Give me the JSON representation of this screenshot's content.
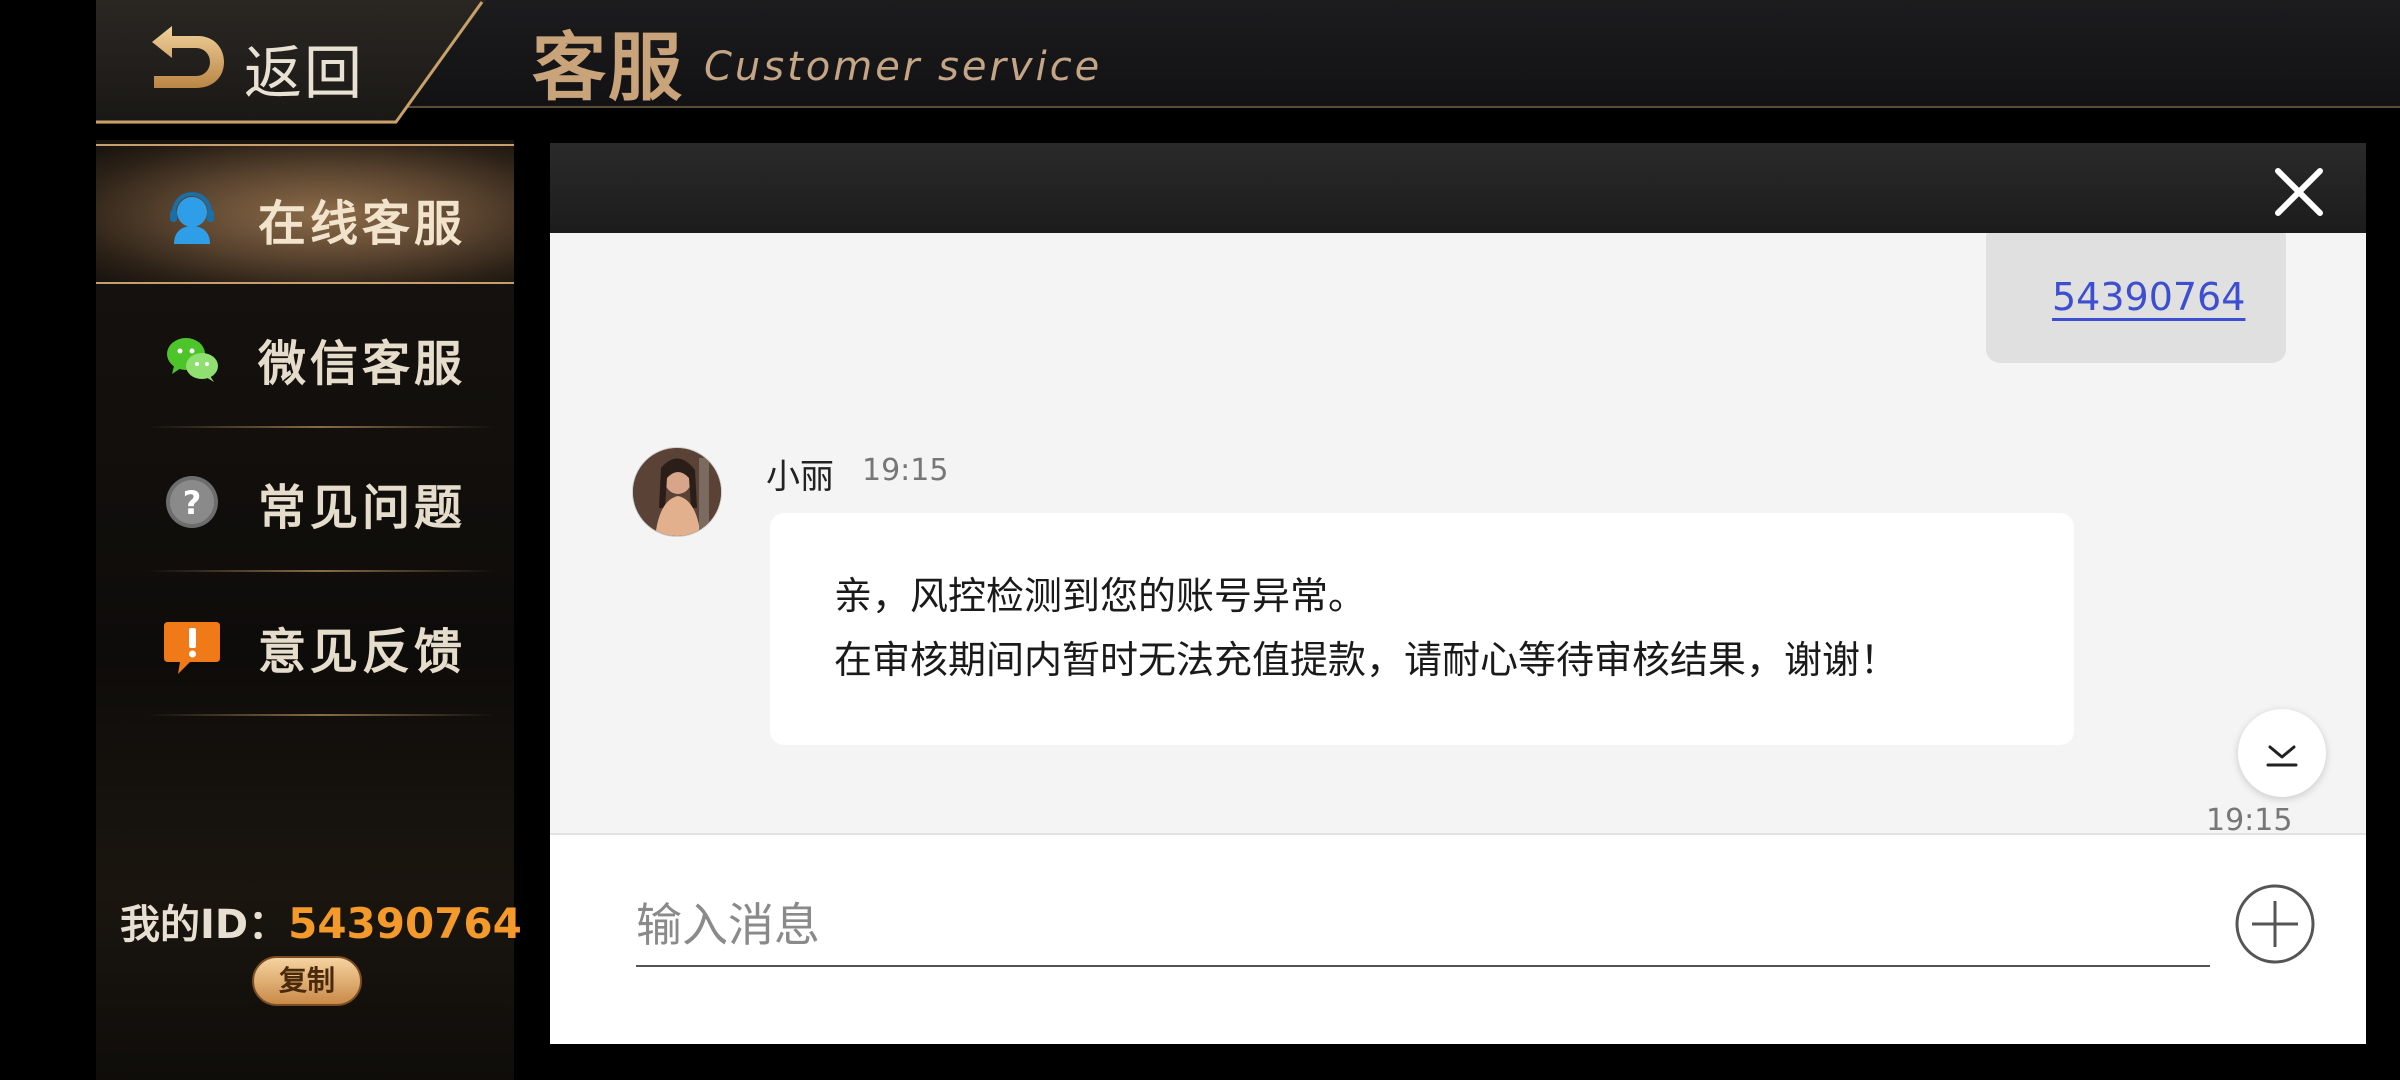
{
  "header": {
    "back_label": "返回",
    "title_cn": "客服",
    "title_en": "Customer service"
  },
  "sidebar": {
    "items": [
      {
        "label": "在线客服",
        "icon": "support-agent-icon",
        "active": true
      },
      {
        "label": "微信客服",
        "icon": "wechat-icon",
        "active": false
      },
      {
        "label": "常见问题",
        "icon": "question-icon",
        "active": false
      },
      {
        "label": "意见反馈",
        "icon": "feedback-icon",
        "active": false
      }
    ],
    "id_label": "我的ID：",
    "id_value": "54390764",
    "copy_label": "复制"
  },
  "chat": {
    "sent_message": "54390764",
    "agent_name": "小丽",
    "agent_time": "19:15",
    "received_lines": [
      "亲，风控检测到您的账号异常。",
      "在审核期间内暂时无法充值提款，请耐心等待审核结果，谢谢！"
    ],
    "bottom_time": "19:15",
    "input_placeholder": "输入消息"
  },
  "colors": {
    "accent_gold": "#c9a47a",
    "id_orange": "#f39a2a",
    "link_blue": "#3d4fd0"
  }
}
